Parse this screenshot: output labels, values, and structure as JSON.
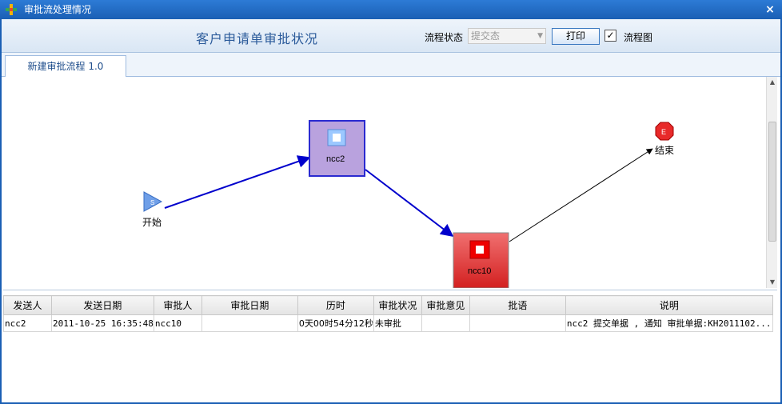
{
  "window": {
    "title": "审批流处理情况",
    "close_symbol": "×"
  },
  "header": {
    "main_title": "客户申请单审批状况",
    "status_label": "流程状态",
    "status_value": "提交态",
    "print_label": "打印",
    "flow_checkbox_checked": true,
    "flow_label": "流程图"
  },
  "tabs": [
    {
      "label": "新建审批流程 1.0",
      "active": true
    }
  ],
  "flow": {
    "start_label": "开始",
    "start_badge": "S",
    "node1_label": "ncc2",
    "node2_label": "ncc10",
    "end_label": "结束",
    "end_badge": "E",
    "colors": {
      "node_done": "#b9a2de",
      "node_pending": "#e23a3a",
      "edge_done": "#0000cc",
      "edge_pending": "#000000"
    }
  },
  "grid": {
    "columns": [
      "发送人",
      "发送日期",
      "审批人",
      "审批日期",
      "历时",
      "审批状况",
      "审批意见",
      "批语",
      "说明"
    ],
    "rows": [
      [
        "ncc2",
        "2011-10-25 16:35:48",
        "ncc10",
        "",
        "0天00时54分12秒",
        "未审批",
        "",
        "",
        "ncc2 提交单据 , 通知 审批单据:KH2011102..."
      ]
    ]
  }
}
